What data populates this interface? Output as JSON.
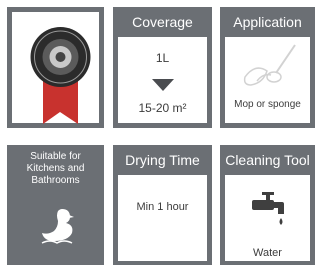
{
  "tiles": {
    "badge": {},
    "coverage": {
      "title": "Coverage",
      "volume": "1L",
      "area": "15-20 m²"
    },
    "application": {
      "title": "Application",
      "method": "Mop or sponge"
    },
    "suitable": {
      "text": [
        "Suitable for",
        "Kitchens and",
        "Bathrooms"
      ]
    },
    "drying": {
      "title": "Drying Time",
      "value": "Min 1 hour"
    },
    "cleaning": {
      "title": "Cleaning Tool",
      "value": "Water"
    }
  },
  "colors": {
    "tile_grey": "#6b6f74",
    "text_dark": "#3c3c3c",
    "ribbon_red": "#c8322e"
  }
}
